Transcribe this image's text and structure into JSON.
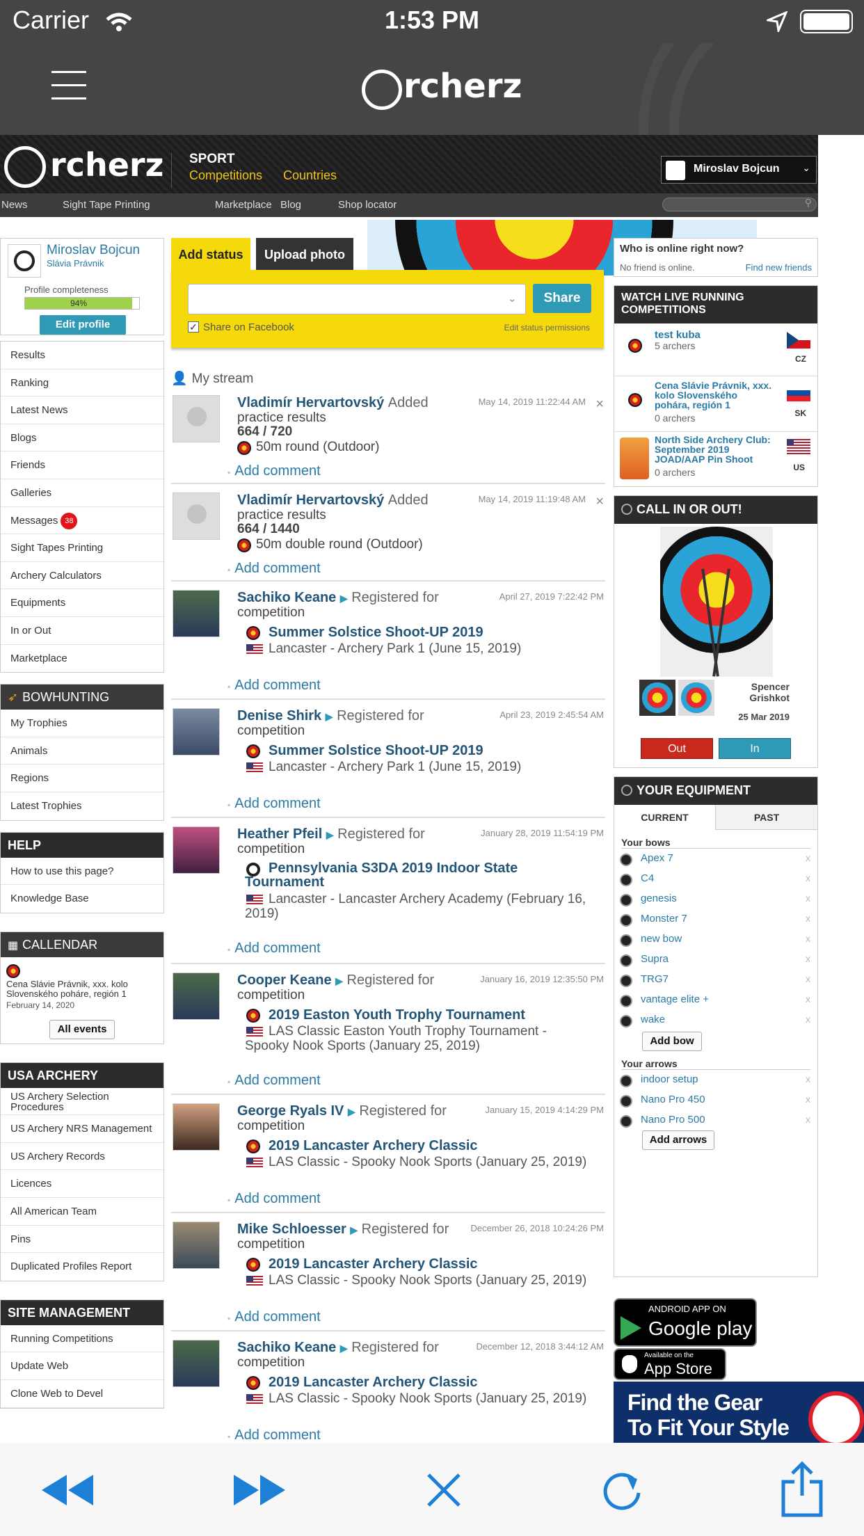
{
  "status_bar": {
    "carrier": "Carrier",
    "time": "1:53 PM"
  },
  "app_nav": {
    "logo": "rcherz"
  },
  "site": {
    "logo": "rcherz",
    "sport_label": "SPORT",
    "sport_links": [
      "Competitions",
      "Countries"
    ],
    "user_name": "Miroslav Bojcun",
    "nav": [
      "News",
      "Sight Tape Printing",
      "Marketplace",
      "Blog",
      "Shop locator"
    ]
  },
  "profile": {
    "name": "Miroslav Bojcun",
    "club": "Slávia Právnik",
    "completeness_label": "Profile completeness",
    "completeness_value": "94%",
    "completeness_fraction": 0.94,
    "edit_label": "Edit profile"
  },
  "left_menu": [
    "Results",
    "Ranking",
    "Latest News",
    "Blogs",
    "Friends",
    "Galleries",
    "Messages",
    "Sight Tapes Printing",
    "Archery Calculators",
    "Equipments",
    "In or Out",
    "Marketplace"
  ],
  "messages_badge": "38",
  "bowhunting": {
    "title": "BOWHUNTING",
    "items": [
      "My Trophies",
      "Animals",
      "Regions",
      "Latest Trophies"
    ]
  },
  "help": {
    "title": "HELP",
    "items": [
      "How to use this page?",
      "Knowledge Base"
    ]
  },
  "calendar": {
    "title": "CALLENDAR",
    "event": "Cena Slávie Právnik, xxx. kolo Slovenského poháre, región 1",
    "date": "February 14, 2020",
    "button": "All events"
  },
  "usa_archery": {
    "title": "USA ARCHERY",
    "items": [
      "US Archery Selection Procedures",
      "US Archery NRS Management",
      "US Archery Records",
      "Licences",
      "All American Team",
      "Pins",
      "Duplicated Profiles Report"
    ]
  },
  "site_management": {
    "title": "SITE MANAGEMENT",
    "items": [
      "Running Competitions",
      "Update Web",
      "Clone Web to Devel"
    ]
  },
  "status": {
    "tab_add": "Add status",
    "tab_upload": "Upload photo",
    "share_button": "Share",
    "share_facebook": "Share on Facebook",
    "permissions": "Edit status permissions"
  },
  "stream_title": "My stream",
  "feed": [
    {
      "author": "Vladimír Hervartovský",
      "action": "Added",
      "action2": "practice results",
      "time": "May 14, 2019 11:22:44 AM",
      "score": "664 / 720",
      "round": "50m round (Outdoor)",
      "comment": "Add comment"
    },
    {
      "author": "Vladimír Hervartovský",
      "action": "Added",
      "action2": "practice results",
      "time": "May 14, 2019 11:19:48 AM",
      "score": "664 / 1440",
      "round": "50m double round (Outdoor)",
      "comment": "Add comment"
    },
    {
      "author": "Sachiko Keane",
      "action": "Registered for",
      "action2": "competition",
      "time": "April 27, 2019 7:22:42 PM",
      "competition": "Summer Solstice Shoot-UP 2019",
      "place": "Lancaster - Archery Park 1 (June 15, 2019)",
      "comment": "Add comment"
    },
    {
      "author": "Denise Shirk",
      "action": "Registered for",
      "action2": "competition",
      "time": "April 23, 2019 2:45:54 AM",
      "competition": "Summer Solstice Shoot-UP 2019",
      "place": "Lancaster - Archery Park 1 (June 15, 2019)",
      "comment": "Add comment"
    },
    {
      "author": "Heather Pfeil",
      "action": "Registered for",
      "action2": "competition",
      "time": "January 28, 2019 11:54:19 PM",
      "competition": "Pennsylvania S3DA 2019 Indoor State Tournament",
      "place": "Lancaster - Lancaster Archery Academy (February 16, 2019)",
      "comment": "Add comment"
    },
    {
      "author": "Cooper Keane",
      "action": "Registered for",
      "action2": "competition",
      "time": "January 16, 2019 12:35:50 PM",
      "competition": "2019 Easton Youth Trophy Tournament",
      "place": "LAS Classic Easton Youth Trophy Tournament - Spooky Nook Sports (January 25, 2019)",
      "comment": "Add comment"
    },
    {
      "author": "George Ryals IV",
      "action": "Registered for",
      "action2": "competition",
      "time": "January 15, 2019 4:14:29 PM",
      "competition": "2019 Lancaster Archery Classic",
      "place": "LAS Classic - Spooky Nook Sports (January 25, 2019)",
      "comment": "Add comment"
    },
    {
      "author": "Mike Schloesser",
      "action": "Registered for",
      "action2": "competition",
      "time": "December 26, 2018 10:24:26 PM",
      "competition": "2019 Lancaster Archery Classic",
      "place": "LAS Classic - Spooky Nook Sports (January 25, 2019)",
      "comment": "Add comment"
    },
    {
      "author": "Sachiko Keane",
      "action": "Registered for",
      "action2": "competition",
      "time": "December 12, 2018 3:44:12 AM",
      "competition": "2019 Lancaster Archery Classic",
      "place": "LAS Classic - Spooky Nook Sports (January 25, 2019)",
      "comment": "Add comment"
    }
  ],
  "online": {
    "title": "Who is online right now?",
    "empty": "No friend is online.",
    "find": "Find new friends"
  },
  "live": {
    "title": "WATCH LIVE RUNNING COMPETITIONS",
    "items": [
      {
        "name": "test kuba",
        "count": "5 archers",
        "country": "CZ"
      },
      {
        "name": "Cena Slávie Právnik, xxx. kolo Slovenského pohára, región 1",
        "count": "0 archers",
        "country": "SK"
      },
      {
        "name": "North Side Archery Club: September 2019 JOAD/AAP Pin Shoot",
        "count": "0 archers",
        "country": "US"
      }
    ]
  },
  "call_in_out": {
    "title": "CALL IN OR OUT!",
    "user": "Spencer Grishkot",
    "date": "25 Mar 2019",
    "out": "Out",
    "in": "In"
  },
  "equipment": {
    "title": "YOUR EQUIPMENT",
    "tab_current": "CURRENT",
    "tab_past": "PAST",
    "bows_title": "Your bows",
    "bows": [
      "Apex 7",
      "C4",
      "genesis",
      "Monster 7",
      "new bow",
      "Supra",
      "TRG7",
      "vantage elite +",
      "wake"
    ],
    "add_bow": "Add bow",
    "arrows_title": "Your arrows",
    "arrows": [
      "indoor setup",
      "Nano Pro 450",
      "Nano Pro 500"
    ],
    "add_arrows": "Add arrows",
    "delete_mark": "x"
  },
  "apps": {
    "android_small": "ANDROID APP ON",
    "android_big": "Google play",
    "ios_small": "Available on the",
    "ios_big": "App Store"
  },
  "ad": {
    "line1": "Find the Gear",
    "line2": "To Fit Your Style"
  },
  "colors": {
    "accent": "#f5d90a",
    "link": "#225577",
    "header": "#1e1e1e"
  }
}
